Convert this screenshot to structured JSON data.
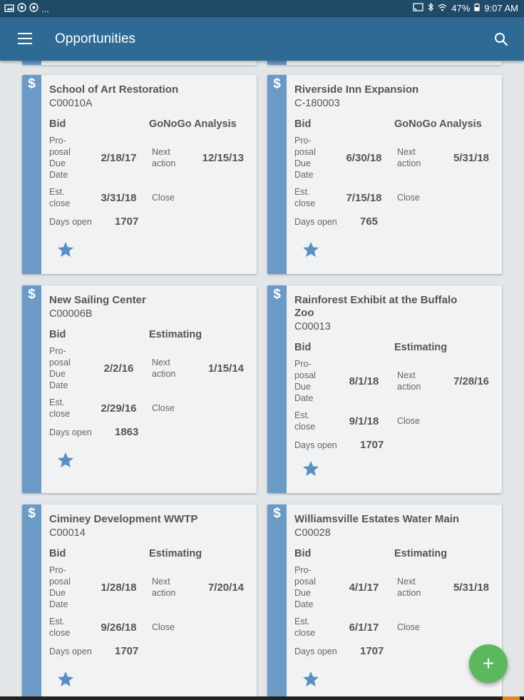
{
  "status_bar": {
    "left_icons": [
      "image-icon",
      "camera-icon",
      "camera-icon"
    ],
    "dots": "...",
    "battery": "47%",
    "time": "9:07 AM"
  },
  "app_bar": {
    "title": "Opportunities"
  },
  "cards": [
    {
      "title": "School of Art Restoration",
      "id": "C00010A",
      "stage": "Bid",
      "status": "GoNoGo Analysis",
      "proposal_label": "Pro-\nposal\nDue\nDate",
      "proposal_due": "2/18/17",
      "next_label": "Next\naction",
      "next_action": "12/15/13",
      "est_label": "Est.\nclose",
      "est_close": "3/31/18",
      "close_label": "Close",
      "days_label": "Days open",
      "days_open": "1707"
    },
    {
      "title": "Riverside Inn Expansion",
      "id": "C-180003",
      "stage": "Bid",
      "status": "GoNoGo Analysis",
      "proposal_label": "Pro-\nposal\nDue\nDate",
      "proposal_due": "6/30/18",
      "next_label": "Next\naction",
      "next_action": "5/31/18",
      "est_label": "Est.\nclose",
      "est_close": "7/15/18",
      "close_label": "Close",
      "days_label": "Days open",
      "days_open": "765"
    },
    {
      "title": "New Sailing Center",
      "id": "C00006B",
      "stage": "Bid",
      "status": "Estimating",
      "proposal_label": "Pro-\nposal\nDue\nDate",
      "proposal_due": "2/2/16",
      "next_label": "Next\naction",
      "next_action": "1/15/14",
      "est_label": "Est.\nclose",
      "est_close": "2/29/16",
      "close_label": "Close",
      "days_label": "Days open",
      "days_open": "1863"
    },
    {
      "title": "Rainforest Exhibit at the Buffalo Zoo",
      "id": "C00013",
      "stage": "Bid",
      "status": "Estimating",
      "proposal_label": "Pro-\nposal\nDue\nDate",
      "proposal_due": "8/1/18",
      "next_label": "Next\naction",
      "next_action": "7/28/16",
      "est_label": "Est.\nclose",
      "est_close": "9/1/18",
      "close_label": "Close",
      "days_label": "Days open",
      "days_open": "1707"
    },
    {
      "title": "Ciminey Development WWTP",
      "id": "C00014",
      "stage": "Bid",
      "status": "Estimating",
      "proposal_label": "Pro-\nposal\nDue\nDate",
      "proposal_due": "1/28/18",
      "next_label": "Next\naction",
      "next_action": "7/20/14",
      "est_label": "Est.\nclose",
      "est_close": "9/26/18",
      "close_label": "Close",
      "days_label": "Days open",
      "days_open": "1707"
    },
    {
      "title": "Williamsville Estates Water Main",
      "id": "C00028",
      "stage": "Bid",
      "status": "Estimating",
      "proposal_label": "Pro-\nposal\nDue\nDate",
      "proposal_due": "4/1/17",
      "next_label": "Next\naction",
      "next_action": "5/31/18",
      "est_label": "Est.\nclose",
      "est_close": "6/1/17",
      "close_label": "Close",
      "days_label": "Days open",
      "days_open": "1707"
    }
  ],
  "card_icon": "dollar-icon",
  "favorite_icon": "star-icon",
  "fab": {
    "label": "+"
  },
  "colors": {
    "app_bar": "#2e6a94",
    "status_bar": "#1f4a68",
    "card_stripe": "#6b9ac4",
    "star": "#5b8fc4",
    "fab": "#5cb85c",
    "background": "#e3e6e9"
  }
}
